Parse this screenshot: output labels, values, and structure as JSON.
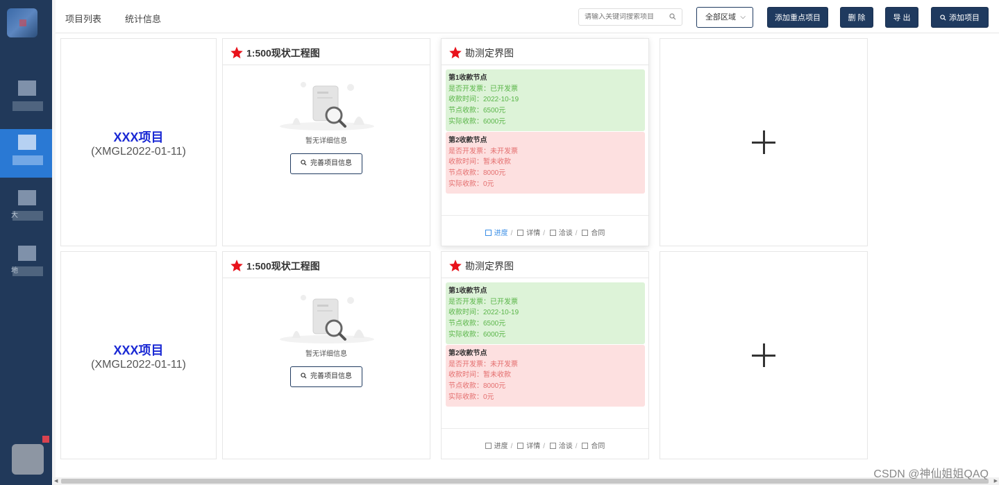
{
  "tabs": [
    {
      "label": "项目列表"
    },
    {
      "label": "统计信息"
    }
  ],
  "toolbar": {
    "search_placeholder": "请输入关键词搜索项目",
    "region_select": "全部区域",
    "add_key_project": "添加重点项目",
    "delete": "删 除",
    "export": "导 出",
    "add_project": "添加项目"
  },
  "rows": [
    {
      "project": {
        "name": "XXX项目",
        "code": "(XMGL2022-01-11)"
      },
      "card1": {
        "title": "1:500现状工程图",
        "empty_text": "暂无详细信息",
        "complete_btn": "完善项目信息"
      },
      "card2": {
        "title": "勘测定界图",
        "nodes": [
          {
            "title": "第1收款节点",
            "invoice": "是否开发票：已开发票",
            "time": "收款时间：2022-10-19",
            "node_amount": "节点收款：6500元",
            "actual_amount": "实际收款：6000元",
            "status": "green"
          },
          {
            "title": "第2收款节点",
            "invoice": "是否开发票：未开发票",
            "time": "收款时间：暂未收款",
            "node_amount": "节点收款：8000元",
            "actual_amount": "实际收款：0元",
            "status": "red"
          }
        ],
        "footer": {
          "progress": "进度",
          "detail": "详情",
          "negotiation": "洽谈",
          "contract": "合同"
        }
      }
    },
    {
      "project": {
        "name": "XXX项目",
        "code": "(XMGL2022-01-11)"
      },
      "card1": {
        "title": "1:500现状工程图",
        "empty_text": "暂无详细信息",
        "complete_btn": "完善项目信息"
      },
      "card2": {
        "title": "勘测定界图",
        "nodes": [
          {
            "title": "第1收款节点",
            "invoice": "是否开发票：已开发票",
            "time": "收款时间：2022-10-19",
            "node_amount": "节点收款：6500元",
            "actual_amount": "实际收款：6000元",
            "status": "green"
          },
          {
            "title": "第2收款节点",
            "invoice": "是否开发票：未开发票",
            "time": "收款时间：暂未收款",
            "node_amount": "节点收款：8000元",
            "actual_amount": "实际收款：0元",
            "status": "red"
          }
        ],
        "footer": {
          "progress": "进度",
          "detail": "详情",
          "negotiation": "洽谈",
          "contract": "合同"
        }
      }
    }
  ],
  "sidebar": {
    "items": [
      {
        "label": "",
        "active": false
      },
      {
        "label": "",
        "active": true
      },
      {
        "label": "大",
        "active": false
      },
      {
        "label": "地",
        "active": false
      }
    ]
  },
  "watermark": "CSDN @神仙姐姐QAQ",
  "colors": {
    "sidebar_bg": "#21395a",
    "active_nav": "#2a79d4",
    "button_bg": "#1f3a5f",
    "project_name": "#1a29d4",
    "star": "#e8121b",
    "paid_green": "#5ab549",
    "unpaid_red": "#e46f6f"
  }
}
